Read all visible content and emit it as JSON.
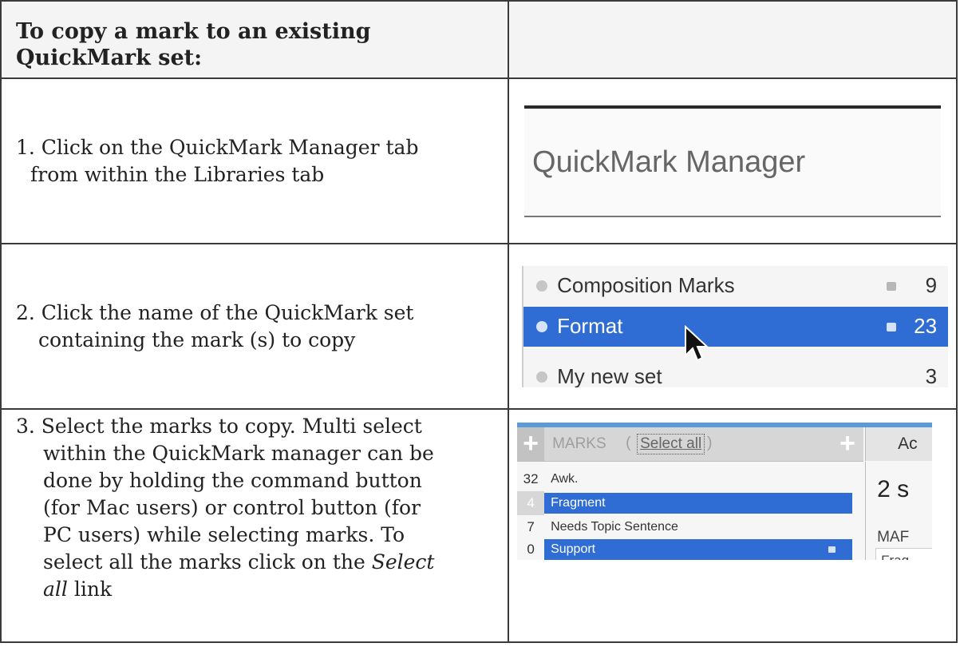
{
  "header": {
    "title_line1": "To copy a mark to an existing",
    "title_line2": "QuickMark set:"
  },
  "steps": [
    {
      "line1": "1.  Click on the QuickMark Manager tab",
      "line2": "from within the Libraries tab"
    },
    {
      "line1": "2. Click the name of the QuickMark set",
      "line2": "containing the mark (s) to copy"
    },
    {
      "line1": "3. Select the marks to copy. Multi select",
      "line2": "within the QuickMark manager can be",
      "line3": "done by holding the command button",
      "line4": "(for Mac users) or control button (for",
      "line5": "PC users) while selecting marks. To",
      "line6_prefix": "select all the marks click on the ",
      "line6_em": "Select",
      "line7_em": "all",
      "line7_suffix": " link"
    }
  ],
  "tab_image": {
    "label": "QuickMark Manager"
  },
  "sets_image": {
    "sets": [
      {
        "name": "Composition Marks",
        "count": "9",
        "locked": true,
        "selected": false
      },
      {
        "name": "Format",
        "count": "23",
        "locked": true,
        "selected": true
      },
      {
        "name": "My new set",
        "count": "3",
        "locked": false,
        "selected": false
      }
    ],
    "selected_color": "#2f6dd5"
  },
  "marks_image": {
    "header_title": "MARKS",
    "paren_open": "(",
    "select_all": "Select all",
    "paren_close": ")",
    "plus": "+",
    "right_header": "Ac",
    "marks": [
      {
        "count": "32",
        "label": "Awk.",
        "selected": false
      },
      {
        "count": "4",
        "label": "Fragment",
        "selected": true
      },
      {
        "count": "7",
        "label": "Needs Topic Sentence",
        "selected": false
      },
      {
        "count": "0",
        "label": "Support",
        "selected": true
      }
    ],
    "right_big": "2 s",
    "right_marks_label": "MAF",
    "right_frag": "Frag"
  }
}
